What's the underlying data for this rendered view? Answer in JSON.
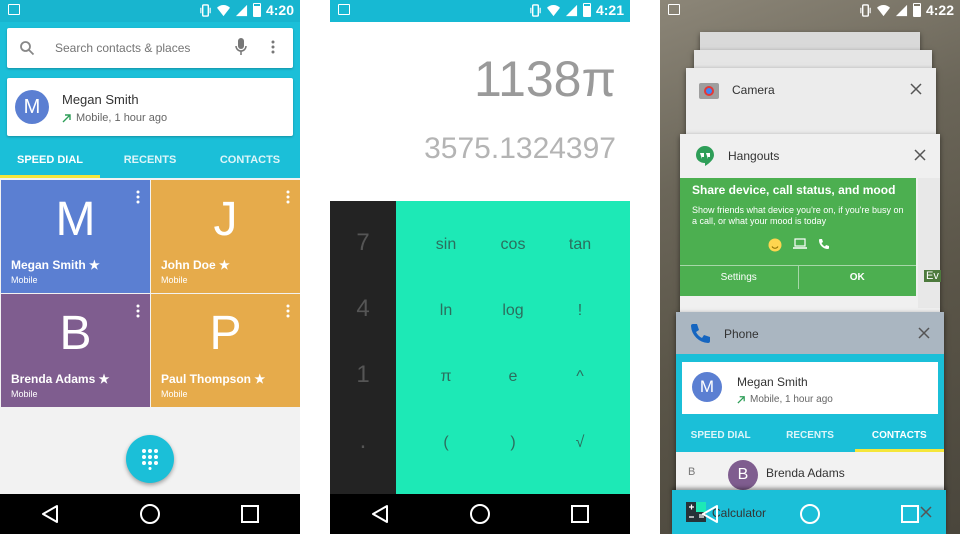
{
  "screen1": {
    "status_time": "4:20",
    "search": {
      "placeholder": "Search contacts & places"
    },
    "recent": {
      "avatar_letter": "M",
      "name": "Megan Smith",
      "detail": "Mobile, 1 hour ago"
    },
    "tabs": [
      {
        "label": "SPEED DIAL"
      },
      {
        "label": "RECENTS"
      },
      {
        "label": "CONTACTS"
      }
    ],
    "speed_dial": [
      {
        "letter": "M",
        "name": "Megan Smith ★",
        "type": "Mobile",
        "color": "#5b7fd2"
      },
      {
        "letter": "J",
        "name": "John Doe ★",
        "type": "Mobile",
        "color": "#e6ab4b"
      },
      {
        "letter": "B",
        "name": "Brenda Adams ★",
        "type": "Mobile",
        "color": "#7f5d8f"
      },
      {
        "letter": "P",
        "name": "Paul Thompson ★",
        "type": "Mobile",
        "color": "#e6ab4b"
      }
    ],
    "accent": "#1bbfd8"
  },
  "screen2": {
    "status_time": "4:21",
    "formula": "1138π",
    "result": "3575.1324397",
    "numpad": [
      "7",
      "4",
      "1",
      "."
    ],
    "advanced": [
      [
        "sin",
        "cos",
        "tan"
      ],
      [
        "ln",
        "log",
        "!"
      ],
      [
        "π",
        "e",
        "^"
      ],
      [
        "(",
        ")",
        "√"
      ]
    ],
    "accent": "#1de9b6"
  },
  "screen3": {
    "status_time": "4:22",
    "camera": {
      "title": "Camera"
    },
    "hangouts": {
      "title": "Hangouts",
      "headline": "Share device, call status, and mood",
      "body": "Show friends what device you're on, if you're busy on a call, or what your mood is today",
      "settings": "Settings",
      "ok": "OK",
      "side_text": "Ev"
    },
    "phone": {
      "title": "Phone",
      "name": "Megan Smith",
      "detail": "Mobile, 1 hour ago",
      "avatar_letter": "M",
      "tabs": [
        "SPEED DIAL",
        "RECENTS",
        "CONTACTS"
      ],
      "list_letter": "B",
      "list_name": "Brenda Adams",
      "list_avatar": "B"
    },
    "calculator": {
      "title": "Calculator"
    }
  }
}
